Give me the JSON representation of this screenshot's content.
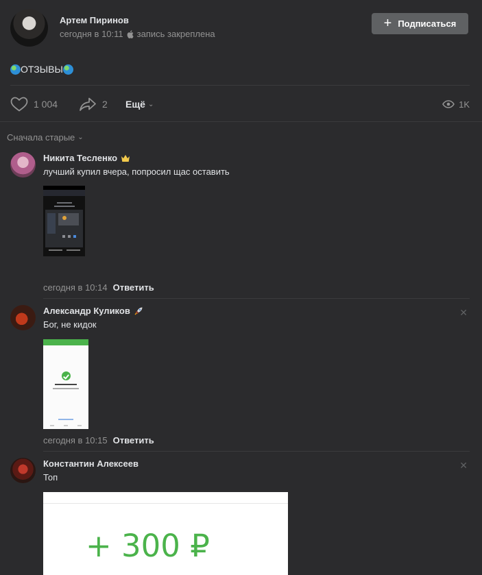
{
  "post": {
    "author": "Артем Пиринов",
    "time": "сегодня в 10:11",
    "pinned": "запись закреплена",
    "subscribe_label": "Подписаться",
    "text": "ОТЗЫВЫ"
  },
  "actions": {
    "likes": "1 004",
    "shares": "2",
    "more_label": "Ещё",
    "views": "1K"
  },
  "sort_label": "Сначала старые",
  "comments": [
    {
      "name": "Никита Тесленко",
      "text": "лучший купил вчера, попросил щас оставить",
      "time": "сегодня в 10:14",
      "reply_label": "Ответить"
    },
    {
      "name": "Александр Куликов",
      "text": "Бог, не кидок",
      "time": "сегодня в 10:15",
      "reply_label": "Ответить"
    },
    {
      "name": "Константин Алексеев",
      "text": "Топ",
      "image_text": "+ 300 ₽"
    }
  ],
  "colors": {
    "background": "#2b2b2d",
    "text_primary": "#e1e3e6",
    "text_secondary": "#939393",
    "button": "#5f6163",
    "success_green": "#4bb34b"
  }
}
